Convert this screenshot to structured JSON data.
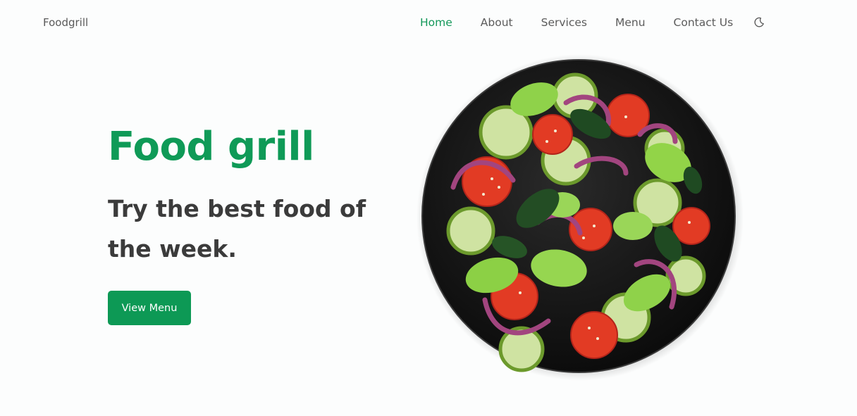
{
  "nav": {
    "brand": "Foodgrill",
    "items": [
      {
        "label": "Home"
      },
      {
        "label": "About"
      },
      {
        "label": "Services"
      },
      {
        "label": "Menu"
      },
      {
        "label": "Contact Us"
      }
    ],
    "theme_icon": "moon-icon"
  },
  "hero": {
    "title": "Food grill",
    "subtitle": "Try the best food of the week.",
    "cta_label": "View Menu",
    "image": "salad-plate-image"
  },
  "colors": {
    "accent": "#0d9955",
    "text_dark": "#3b3b3b",
    "nav_text": "#5b5b5b",
    "background": "#fcfdfd"
  }
}
